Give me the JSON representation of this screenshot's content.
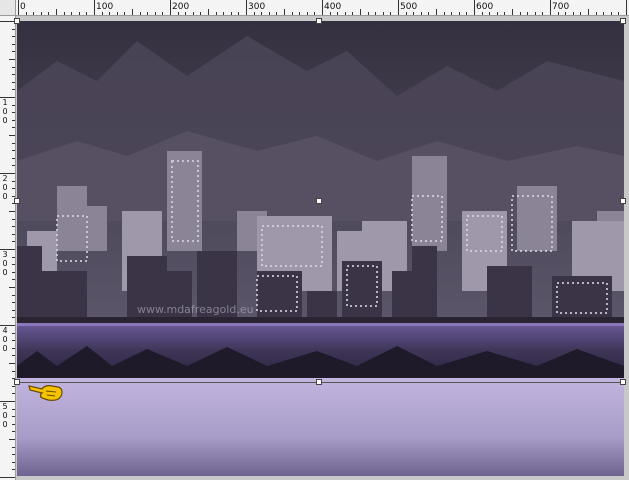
{
  "ruler": {
    "horizontal_labels": [
      "0",
      "100",
      "200",
      "300",
      "400",
      "500",
      "600",
      "700"
    ],
    "vertical_labels": [
      [
        "1",
        "0",
        "0"
      ],
      [
        "2",
        "0",
        "0"
      ],
      [
        "3",
        "0",
        "0"
      ],
      [
        "4",
        "0",
        "0"
      ],
      [
        "5",
        "0",
        "0"
      ]
    ]
  },
  "canvas": {
    "watermark": "www.mdafreagold.eu"
  },
  "icons": {
    "pointer": "hand-pointer-icon"
  },
  "colors": {
    "sky_top": "#3c3848",
    "sky_bottom": "#5a5468",
    "water": "#4a3e6a",
    "lavender": "#b8acd8",
    "lavender_dark": "#8e82b0"
  }
}
